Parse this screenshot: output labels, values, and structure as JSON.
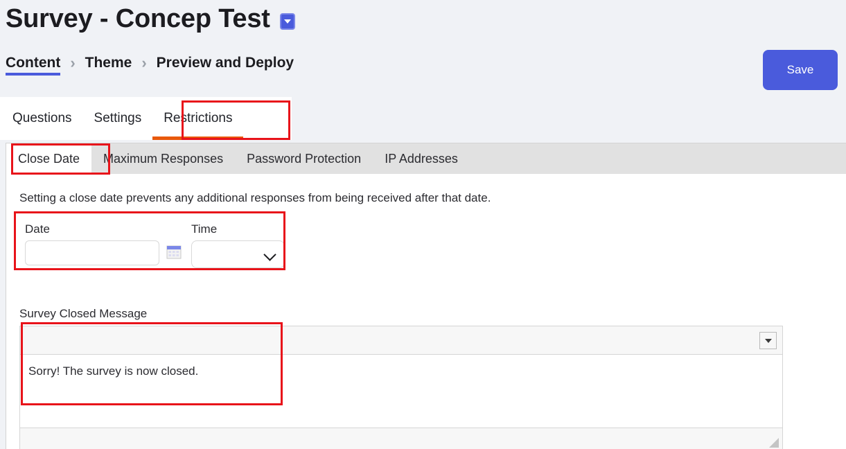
{
  "header": {
    "title": "Survey - Concep Test",
    "title_dropdown_icon": "caret-down-icon",
    "save_label": "Save",
    "breadcrumb": [
      {
        "label": "Content",
        "active": true
      },
      {
        "label": "Theme",
        "active": false
      },
      {
        "label": "Preview and Deploy",
        "active": false
      }
    ],
    "breadcrumb_separator": "›"
  },
  "tabs": [
    {
      "label": "Questions",
      "active": false
    },
    {
      "label": "Settings",
      "active": false
    },
    {
      "label": "Restrictions",
      "active": true
    }
  ],
  "subtabs": [
    {
      "label": "Close Date",
      "active": true
    },
    {
      "label": "Maximum Responses",
      "active": false
    },
    {
      "label": "Password Protection",
      "active": false
    },
    {
      "label": "IP Addresses",
      "active": false
    }
  ],
  "close_date": {
    "description": "Setting a close date prevents any additional responses from being received after that date.",
    "date_label": "Date",
    "date_value": "",
    "date_placeholder": "",
    "calendar_icon": "calendar-icon",
    "time_label": "Time",
    "time_value": "",
    "time_chevron_icon": "chevron-down-icon"
  },
  "survey_closed_message": {
    "label": "Survey Closed Message",
    "toolbar_dropdown_icon": "caret-down-icon",
    "body_text": "Sorry! The survey is now closed.",
    "resize_handle_icon": "resize-grip-icon"
  },
  "colors": {
    "accent_blue": "#4a5bdc",
    "active_tab_orange": "#e8590c",
    "annotation_red": "#e8131a",
    "page_background": "#f0f2f6",
    "subtab_bar": "#e1e1e1"
  }
}
